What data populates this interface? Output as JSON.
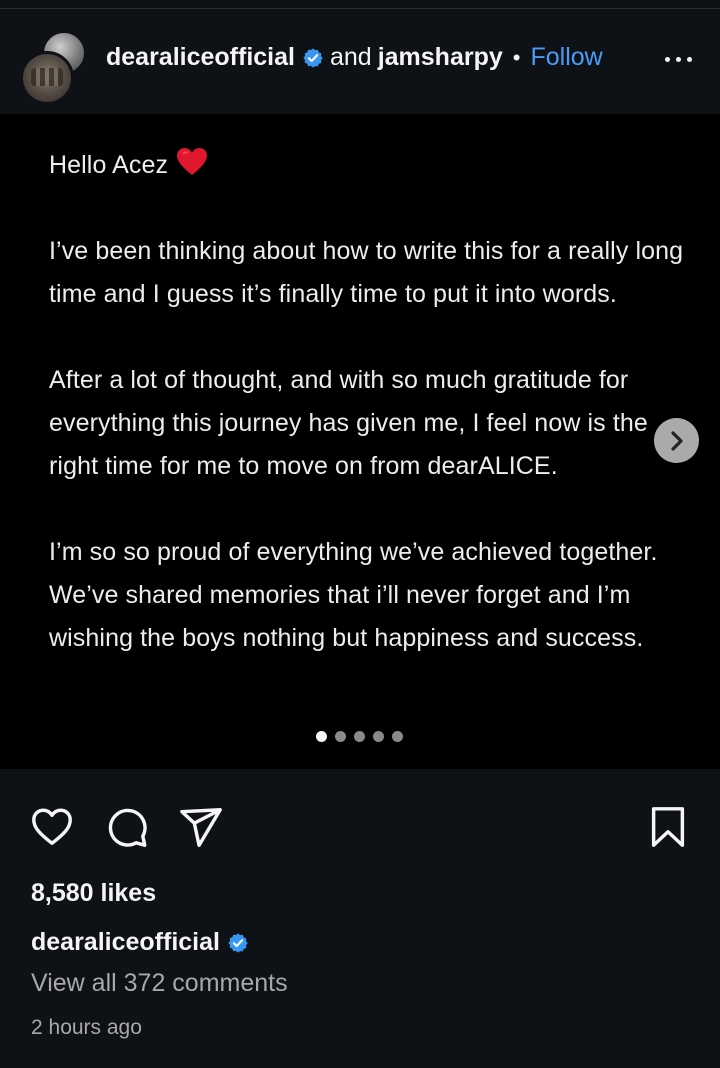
{
  "header": {
    "primary_user": "dearaliceofficial",
    "and_text": "and",
    "secondary_user": "jamsharpy",
    "separator": "•",
    "follow_label": "Follow",
    "more_icon": "more-horizontal-icon"
  },
  "post": {
    "greeting": "Hello Acez",
    "greeting_emoji": "red-heart-emoji",
    "paragraphs": [
      "I’ve been thinking about how to write this for a really long time and I guess it’s finally time to put it into words.",
      "After a lot of thought, and with so much gratitude for everything this journey has given me, I feel now is the right time for me to move on from dearALICE.",
      "I’m so so proud of everything we’ve achieved together. We’ve shared memories that i’ll never forget and I’m wishing the boys nothing but happiness and success."
    ],
    "carousel": {
      "total": 5,
      "active_index": 0
    }
  },
  "actions": {
    "like_icon": "heart-outline-icon",
    "comment_icon": "comment-bubble-icon",
    "share_icon": "paper-plane-icon",
    "save_icon": "bookmark-icon"
  },
  "footer": {
    "likes": "8,580 likes",
    "caption_user": "dearaliceofficial",
    "view_comments": "View all 372 comments",
    "timestamp": "2 hours ago"
  },
  "colors": {
    "background": "#0e1116",
    "image_background": "#000000",
    "link_blue": "#4a9cf6",
    "verified_blue": "#3897f0",
    "muted_text": "#a8a8a8",
    "heart_red": "#e0182d"
  }
}
